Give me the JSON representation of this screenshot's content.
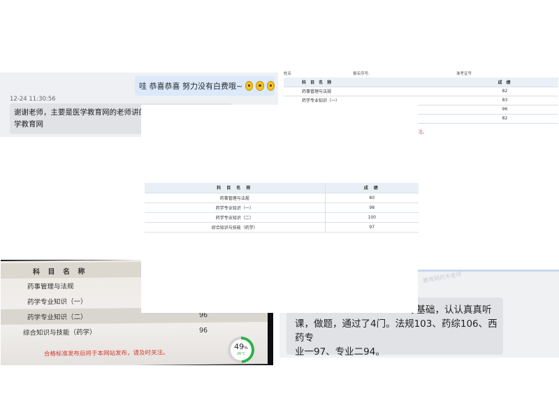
{
  "chat_top": {
    "sent_message": "哇  恭喜恭喜  努力没有白费哦~",
    "timestamp": "12-24 11:30:56",
    "reply_line1": "谢谢老师，主要是医学教育网的老师讲的好",
    "reply_line2": "学教育网"
  },
  "score_table_top": {
    "header_left": "姓名",
    "header_mid": "报名序号:",
    "header_right": "准考证号",
    "col_subject": "科 目 名 称",
    "col_score": "成  绩",
    "rows": [
      {
        "subject": "药事管理与法规",
        "score": "82"
      },
      {
        "subject": "药学专业知识（一）",
        "score": "83"
      },
      {
        "subject": "",
        "score": "96"
      },
      {
        "subject": "",
        "score": "82"
      }
    ],
    "note": "注。"
  },
  "score_table_center": {
    "col_subject": "科 目 名 称",
    "col_score": "成 绩",
    "rows": [
      {
        "subject": "药事管理与法规",
        "score": "80"
      },
      {
        "subject": "药学专业知识（一）",
        "score": "98"
      },
      {
        "subject": "药学专业知识（二）",
        "score": "100"
      },
      {
        "subject": "综合知识与技能（药学）",
        "score": "97"
      }
    ]
  },
  "photo_table": {
    "col_subject": "科 目 名 称",
    "rows": [
      {
        "subject": "药事管理与法规",
        "score": ""
      },
      {
        "subject": "药学专业知识（一）",
        "score": ""
      },
      {
        "subject": "药学专业知识（二）",
        "score": "96"
      },
      {
        "subject": "综合知识与技能（药学）",
        "score": "96"
      }
    ],
    "note": "合格标准发布后将于本网站发布，请及时关注。",
    "gauge_percent": "49",
    "gauge_percent_sign": "%",
    "gauge_temp": "26°C",
    "gauge_fraction": 0.49
  },
  "chat_bottom": {
    "watermark": "教育网药木老师",
    "line1": "零基础，认认真真听",
    "line2": "课，做题，通过了4门。法规103、药综106、西药专",
    "line3": "业一97、专业二94。"
  },
  "colors": {
    "accent_green": "#2eb24a",
    "note_red": "#d23a30",
    "bubble_blue": "#dbe9fb"
  }
}
